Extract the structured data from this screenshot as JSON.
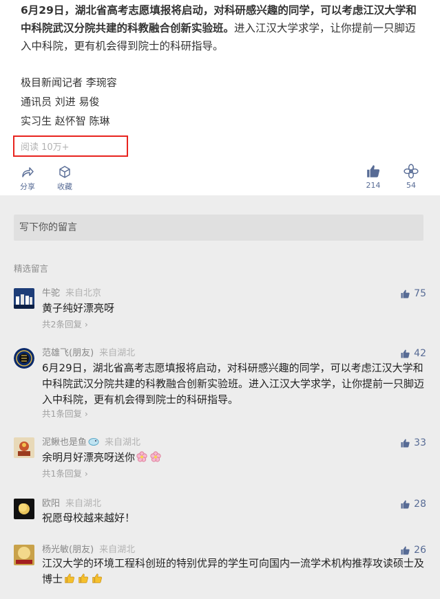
{
  "article": {
    "lead_bold": "6月29日，湖北省高考志愿填报将启动，对科研感兴趣的同学，可以考虑江汉大学和中科院武汉分院共建的科教融合创新实验班。",
    "lead_rest": "进入江汉大学求学，让你提前一只脚迈入中科院，更有机会得到院士的科研指导。",
    "credits": [
      "极目新闻记者 李琬容",
      "通讯员 刘进 易俊",
      "实习生 赵怀智 陈琳"
    ],
    "reads": "阅读 10万+"
  },
  "actions": {
    "share": "分享",
    "favorite": "收藏",
    "like_count": "214",
    "wow_count": "54"
  },
  "comment_input": {
    "placeholder": "写下你的留言"
  },
  "section_title": "精选留言",
  "comments": [
    {
      "nick": "牛驼",
      "loc": "来自北京",
      "text": "黄子纯好漂亮呀",
      "reply": "共2条回复",
      "likes": "75"
    },
    {
      "nick": "范雄飞(朋友)",
      "loc": "来自湖北",
      "text": "6月29日，湖北省高考志愿填报将启动，对科研感兴趣的同学，可以考虑江汉大学和中科院武汉分院共建的科教融合创新实验班。进入江汉大学求学，让你提前一只脚迈入中科院，更有机会得到院士的科研指导。",
      "reply": "共1条回复",
      "likes": "42"
    },
    {
      "nick": "泥鳅也是鱼",
      "loc": "来自湖北",
      "text": "余明月好漂亮呀送你",
      "reply": "共1条回复",
      "likes": "33"
    },
    {
      "nick": "欧阳",
      "loc": "来自湖北",
      "text": "祝愿母校越来越好！",
      "reply": "",
      "likes": "28"
    },
    {
      "nick": "杨光敏(朋友)",
      "loc": "来自湖北",
      "text": "江汉大学的环境工程科创班的特别优异的学生可向国内一流学术机构推荐攻读硕士及博士",
      "reply": "",
      "likes": "26"
    }
  ],
  "colors": {
    "link": "#576b95",
    "highlight": "#e8231e",
    "bg": "#ededed"
  }
}
